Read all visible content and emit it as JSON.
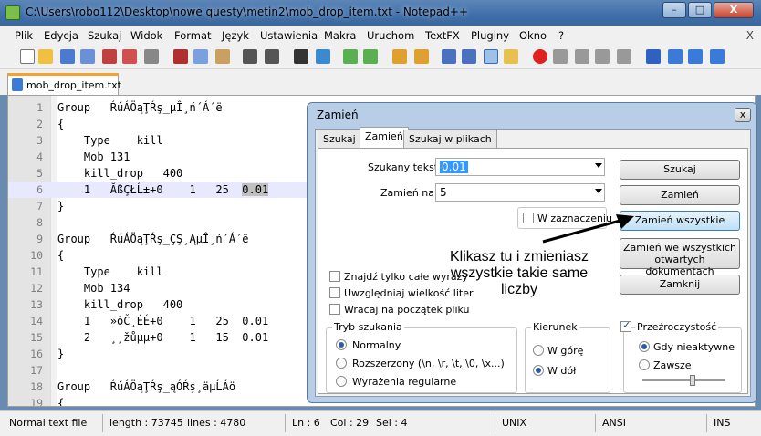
{
  "window": {
    "title": "C:\\Users\\robo112\\Desktop\\nowe questy\\metin2\\mob_drop_item.txt - Notepad++",
    "btn_min": "–",
    "btn_max": "□",
    "btn_close": "X"
  },
  "menu": [
    "Plik",
    "Edycja",
    "Szukaj",
    "Widok",
    "Format",
    "Język",
    "Ustawienia",
    "Makra",
    "Uruchom",
    "TextFX",
    "Pluginy",
    "Okno",
    "?"
  ],
  "menu_close": "X",
  "tab": {
    "label": "mob_drop_item.txt"
  },
  "editor": {
    "lines": [
      {
        "n": "1",
        "text": "Group   ŔúÁÖąŢŔş_µÎ¸ń´Á´ë"
      },
      {
        "n": "2",
        "text": "{"
      },
      {
        "n": "3",
        "text": "    Type    kill"
      },
      {
        "n": "4",
        "text": "    Mob 131"
      },
      {
        "n": "5",
        "text": "    kill_drop   400"
      },
      {
        "n": "6",
        "text": "    1   ĂßÇŁĹ±+0    1   25  ",
        "hl": "0.01"
      },
      {
        "n": "7",
        "text": "}"
      },
      {
        "n": "8",
        "text": ""
      },
      {
        "n": "9",
        "text": "Group   ŔúÁÖąŢŔş_ÇŞ¸ĄµÎ¸ń´Á´ë"
      },
      {
        "n": "10",
        "text": "{"
      },
      {
        "n": "11",
        "text": "    Type    kill"
      },
      {
        "n": "12",
        "text": "    Mob 134"
      },
      {
        "n": "13",
        "text": "    kill_drop   400"
      },
      {
        "n": "14",
        "text": "    1   »ôČ¸ÉÉ+0    1   25  0.01"
      },
      {
        "n": "15",
        "text": "    2   ¸¸žůµµ+0    1   15  0.01"
      },
      {
        "n": "16",
        "text": "}"
      },
      {
        "n": "17",
        "text": ""
      },
      {
        "n": "18",
        "text": "Group   ŔúÁÖąŢŔş_ąÓŔş¸äµĹÁö"
      },
      {
        "n": "19",
        "text": "{"
      }
    ]
  },
  "status": {
    "type": "Normal text file",
    "length": "length : 73745",
    "lines": "lines : 4780",
    "ln": "Ln : 6",
    "col": "Col : 29",
    "sel": "Sel : 4",
    "eol": "UNIX",
    "enc": "ANSI",
    "ins": "INS"
  },
  "dialog": {
    "title": "Zamień",
    "close": "x",
    "tabs": [
      "Szukaj",
      "Zamień",
      "Szukaj w plikach"
    ],
    "find_label": "Szukany tekst :",
    "find_value": "0.01",
    "replace_label": "Zamień na :",
    "replace_value": "5",
    "in_selection": "W zaznaczeniu",
    "buttons": {
      "find": "Szukaj",
      "replace": "Zamień",
      "replace_all": "Zamień wszystkie",
      "replace_all_docs_1": "Zamień we wszystkich",
      "replace_all_docs_2": "otwartych dokumentach",
      "close": "Zamknij"
    },
    "options": {
      "whole_word": "Znajdź tylko całe wyrazy",
      "match_case": "Uwzględniaj wielkość liter",
      "wrap": "Wracaj na początek pliku"
    },
    "search_mode": {
      "title": "Tryb szukania",
      "normal": "Normalny",
      "extended": "Rozszerzony (\\n, \\r, \\t, \\0, \\x...)",
      "regex": "Wyrażenia regularne"
    },
    "direction": {
      "title": "Kierunek",
      "up": "W górę",
      "down": "W dół"
    },
    "transparency": {
      "title": "Przeźroczystość",
      "on_lose_focus": "Gdy nieaktywne",
      "always": "Zawsze"
    },
    "annotation": "Klikasz tu i zmieniasz wszystkie takie same liczby"
  }
}
